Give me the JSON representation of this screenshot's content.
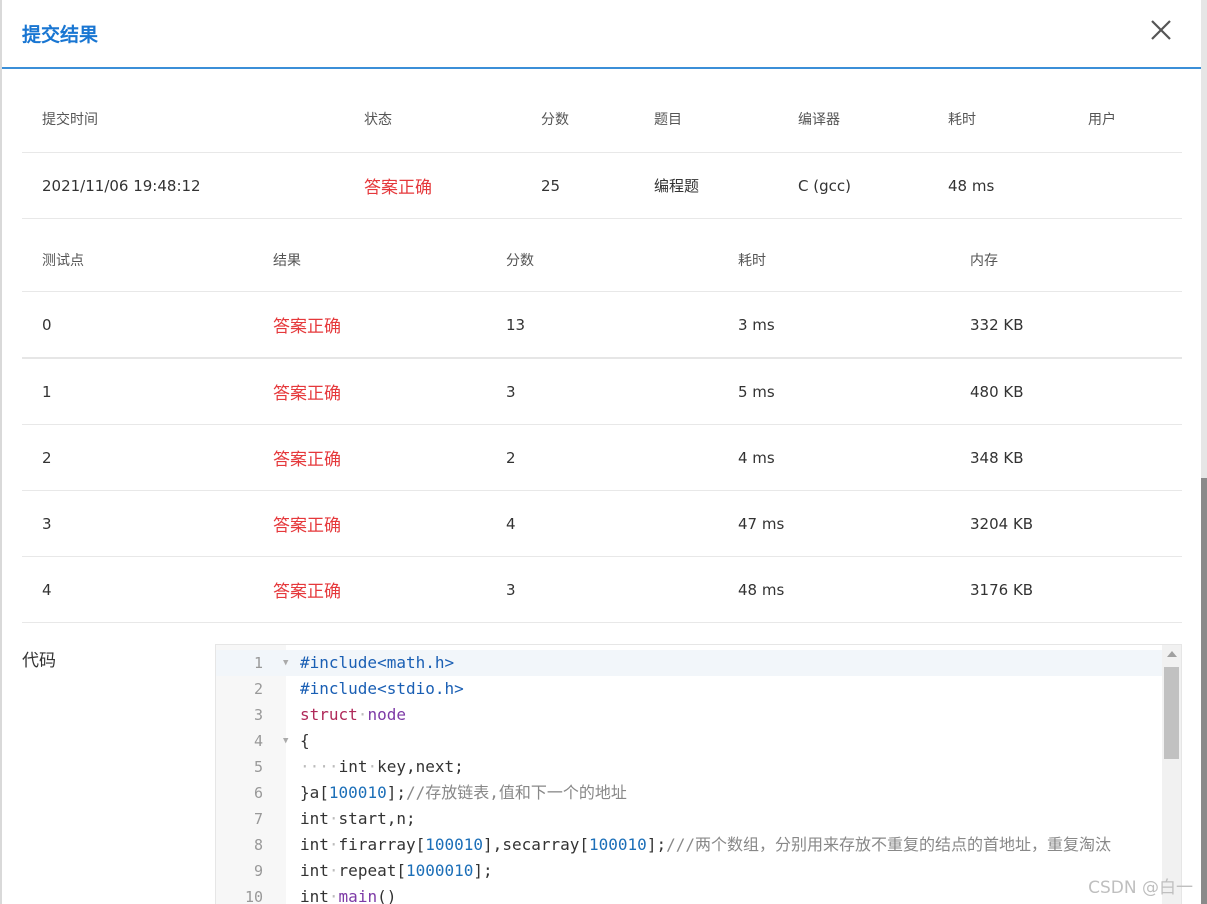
{
  "dialog": {
    "title": "提交结果",
    "close_icon": "close-icon"
  },
  "summary": {
    "headers": [
      "提交时间",
      "状态",
      "分数",
      "题目",
      "编译器",
      "耗时",
      "用户"
    ],
    "row": {
      "time": "2021/11/06 19:48:12",
      "status": "答案正确",
      "score": "25",
      "problem": "编程题",
      "compiler": "C (gcc)",
      "elapsed": "48 ms",
      "user": ""
    }
  },
  "tests": {
    "headers": [
      "测试点",
      "结果",
      "分数",
      "耗时",
      "内存"
    ],
    "rows": [
      {
        "id": "0",
        "result": "答案正确",
        "score": "13",
        "time": "3 ms",
        "memory": "332 KB"
      },
      {
        "id": "1",
        "result": "答案正确",
        "score": "3",
        "time": "5 ms",
        "memory": "480 KB"
      },
      {
        "id": "2",
        "result": "答案正确",
        "score": "2",
        "time": "4 ms",
        "memory": "348 KB"
      },
      {
        "id": "3",
        "result": "答案正确",
        "score": "4",
        "time": "47 ms",
        "memory": "3204 KB"
      },
      {
        "id": "4",
        "result": "答案正确",
        "score": "3",
        "time": "48 ms",
        "memory": "3176 KB"
      }
    ]
  },
  "code": {
    "label": "代码",
    "lines": [
      {
        "n": "1",
        "fold": true,
        "text": "#include<math.h>"
      },
      {
        "n": "2",
        "fold": false,
        "text": "#include<stdio.h>"
      },
      {
        "n": "3",
        "fold": false,
        "text": "struct·node"
      },
      {
        "n": "4",
        "fold": true,
        "text": "{"
      },
      {
        "n": "5",
        "fold": false,
        "text": "····int·key,next;"
      },
      {
        "n": "6",
        "fold": false,
        "text": "}a[100010];//存放链表,值和下一个的地址"
      },
      {
        "n": "7",
        "fold": false,
        "text": "int·start,n;"
      },
      {
        "n": "8",
        "fold": false,
        "text": "int·firarray[100010],secarray[100010];///两个数组，分别用来存放不重复的结点的首地址，重复淘汰"
      },
      {
        "n": "9",
        "fold": false,
        "text": "int·repeat[1000010];"
      },
      {
        "n": "10",
        "fold": false,
        "text": "int·main()"
      }
    ]
  },
  "watermark": "CSDN @白一",
  "colors": {
    "accent": "#1976d2",
    "success_text": "#e5383b"
  }
}
